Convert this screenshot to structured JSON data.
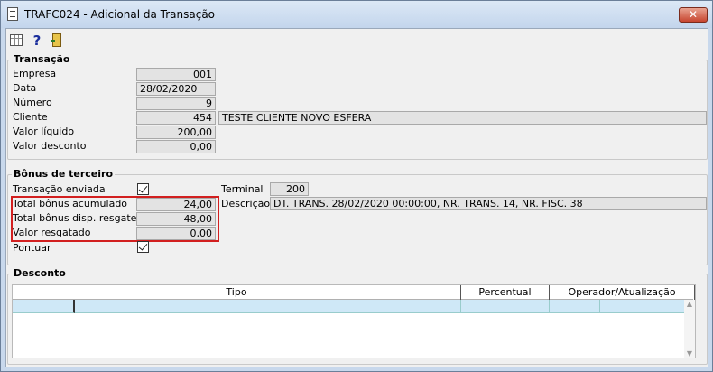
{
  "window": {
    "title": "TRAFC024 - Adicional da Transação",
    "close_label": "✕"
  },
  "toolbar": {
    "grid_icon": "grid-icon",
    "help_label": "?",
    "exit_icon": "door-exit-icon"
  },
  "transacao": {
    "title": "Transação",
    "empresa_label": "Empresa",
    "empresa_value": "001",
    "data_label": "Data",
    "data_value": "28/02/2020",
    "numero_label": "Número",
    "numero_value": "9",
    "cliente_label": "Cliente",
    "cliente_code": "454",
    "cliente_name": "TESTE CLIENTE NOVO ESFERA",
    "valor_liquido_label": "Valor líquido",
    "valor_liquido_value": "200,00",
    "valor_desconto_label": "Valor desconto",
    "valor_desconto_value": "0,00"
  },
  "bonus": {
    "title": "Bônus de terceiro",
    "transacao_enviada_label": "Transação enviada",
    "total_acumulado_label": "Total bônus acumulado",
    "total_acumulado_value": "24,00",
    "total_disp_label": "Total bônus disp. resgate",
    "total_disp_value": "48,00",
    "valor_resgatado_label": "Valor resgatado",
    "valor_resgatado_value": "0,00",
    "pontuar_label": "Pontuar",
    "terminal_label": "Terminal",
    "terminal_value": "200",
    "descricao_label": "Descrição",
    "descricao_value": "DT. TRANS. 28/02/2020 00:00:00, NR. TRANS. 14, NR. FISC. 38"
  },
  "desconto": {
    "title": "Desconto",
    "columns": [
      "Tipo",
      "Percentual",
      "Operador/Atualização"
    ]
  },
  "colors": {
    "highlight": "#d21f1f",
    "selected_row": "#cfe8f7",
    "titlebar": "#c3d5ec"
  }
}
